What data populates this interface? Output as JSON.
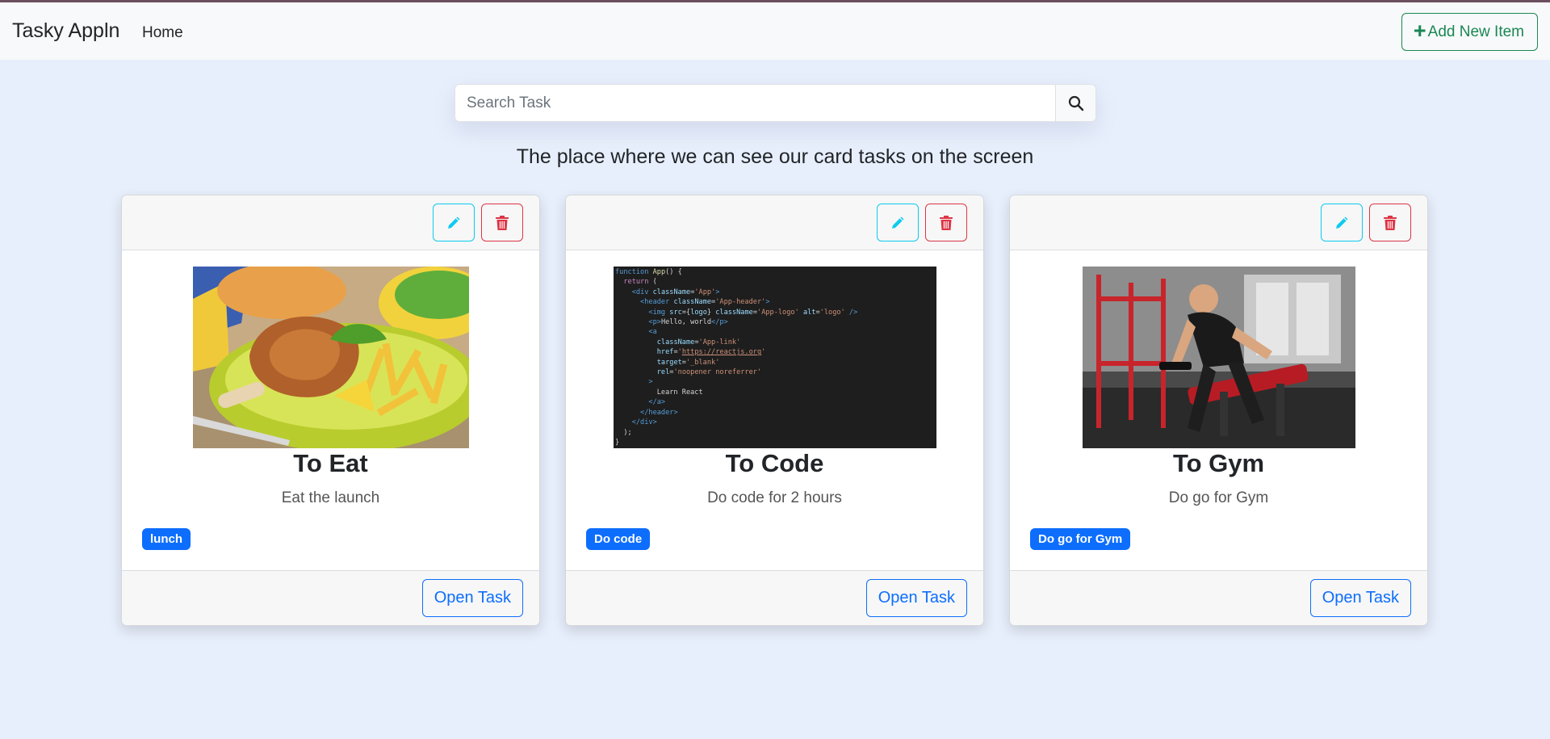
{
  "navbar": {
    "brand": "Tasky Appln",
    "home_link": "Home",
    "add_button_label": "Add New Item",
    "add_button_icon": "plus-icon"
  },
  "search": {
    "placeholder": "Search Task",
    "value": "",
    "button_icon": "search-icon"
  },
  "subtitle": "The place where we can see our card tasks on the screen",
  "cards": [
    {
      "title": "To Eat",
      "description": "Eat the launch",
      "badge": "lunch",
      "open_label": "Open Task",
      "image": "fried-chicken-plate-photo"
    },
    {
      "title": "To Code",
      "description": "Do code for 2 hours",
      "badge": "Do code",
      "open_label": "Open Task",
      "image": "react-code-editor-screenshot"
    },
    {
      "title": "To Gym",
      "description": "Do go for Gym",
      "badge": "Do go for Gym",
      "open_label": "Open Task",
      "image": "man-lifting-dumbbell-gym-photo"
    }
  ],
  "code_lines": [
    "function App() {",
    "  return (",
    "    <div className='App'>",
    "      <header className='App-header'>",
    "        <img src={logo} className='App-logo' alt='logo' />",
    "        <p>Hello, world</p>",
    "        <a",
    "          className='App-link'",
    "          href='https://reactjs.org'",
    "          target='_blank'",
    "          rel='noopener noreferrer'",
    "        >",
    "          Learn React",
    "        </a>",
    "      </header>",
    "    </div>",
    "  );",
    "}"
  ],
  "colors": {
    "page_bg": "#e8effc",
    "success": "#198754",
    "primary": "#0d6efd",
    "info": "#0dcaf0",
    "danger": "#dc3545"
  }
}
